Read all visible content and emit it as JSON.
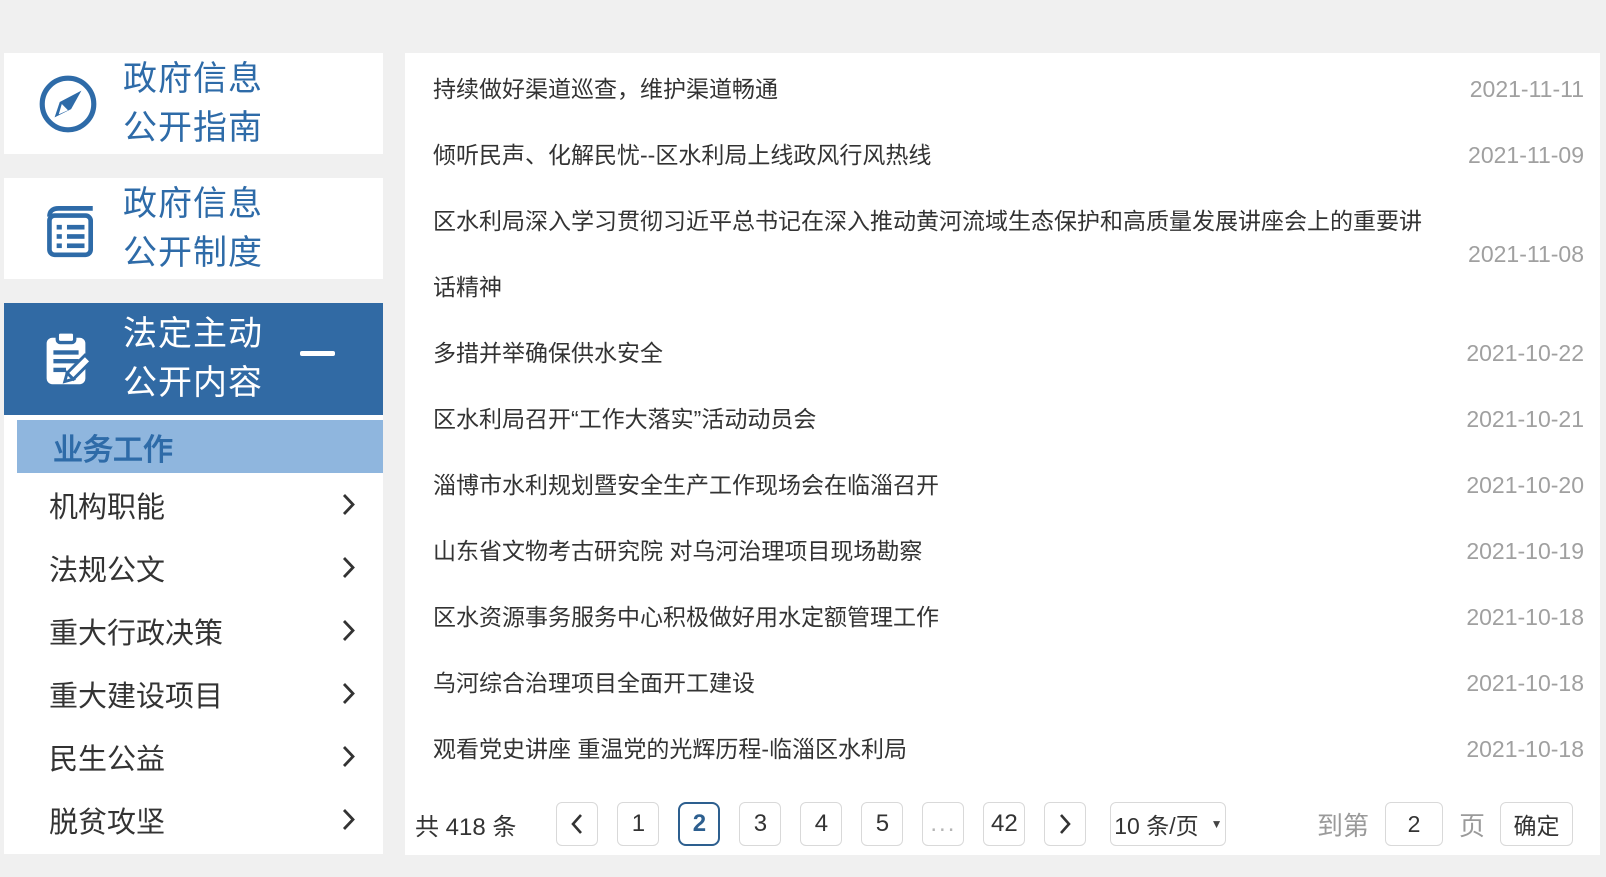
{
  "page": {
    "background_color": "#f0f0f0",
    "accent_color": "#2e6ba8",
    "panel_blue": "#316aa4",
    "highlight_blue": "#8fb6de"
  },
  "sidebar": {
    "cards": [
      {
        "line1": "政府信息",
        "line2": "公开指南",
        "icon": "compass-icon",
        "active": false
      },
      {
        "line1": "政府信息",
        "line2": "公开制度",
        "icon": "book-icon",
        "active": false
      },
      {
        "line1": "法定主动",
        "line2": "公开内容",
        "icon": "clipboard-pencil-icon",
        "active": true
      }
    ],
    "menu_active": "业务工作",
    "menu_items": [
      "机构职能",
      "法规公文",
      "重大行政决策",
      "重大建设项目",
      "民生公益",
      "脱贫攻坚"
    ]
  },
  "news": {
    "items": [
      {
        "title": "持续做好渠道巡查，维护渠道畅通",
        "date": "2021-11-11"
      },
      {
        "title": "倾听民声、化解民忧--区水利局上线政风行风热线",
        "date": "2021-11-09"
      },
      {
        "title": "区水利局深入学习贯彻习近平总书记在深入推动黄河流域生态保护和高质量发展讲座会上的重要讲话精神",
        "date": "2021-11-08"
      },
      {
        "title": "多措并举确保供水安全",
        "date": "2021-10-22"
      },
      {
        "title": "区水利局召开“工作大落实”活动动员会",
        "date": "2021-10-21"
      },
      {
        "title": "淄博市水利规划暨安全生产工作现场会在临淄召开",
        "date": "2021-10-20"
      },
      {
        "title": "山东省文物考古研究院 对乌河治理项目现场勘察",
        "date": "2021-10-19"
      },
      {
        "title": "区水资源事务服务中心积极做好用水定额管理工作",
        "date": "2021-10-18"
      },
      {
        "title": "乌河综合治理项目全面开工建设",
        "date": "2021-10-18"
      },
      {
        "title": "观看党史讲座 重温党的光辉历程-临淄区水利局",
        "date": "2021-10-18"
      }
    ]
  },
  "pagination": {
    "total_text": "共 418 条",
    "pages": [
      "1",
      "2",
      "3",
      "4",
      "5",
      "...",
      "42"
    ],
    "active_page": "2",
    "page_size_label": "10 条/页",
    "goto_prefix": "到第",
    "goto_value": "2",
    "goto_suffix": "页",
    "confirm_label": "确定"
  }
}
